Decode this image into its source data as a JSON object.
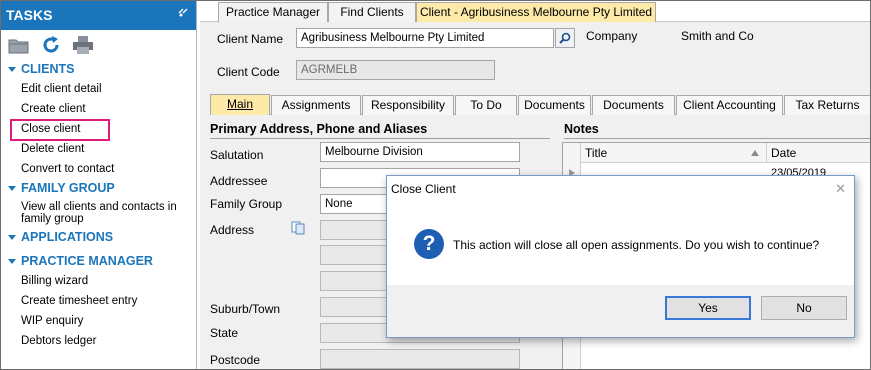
{
  "sidebar": {
    "title": "TASKS",
    "tool_icons": [
      "folder-icon",
      "refresh-icon",
      "print-icon"
    ],
    "sections": [
      {
        "label": "CLIENTS",
        "items": [
          "Edit client detail",
          "Create client",
          "Close client",
          "Delete client",
          "Convert to contact"
        ]
      },
      {
        "label": "FAMILY GROUP",
        "items": [
          "View all clients and contacts in family group"
        ]
      },
      {
        "label": "APPLICATIONS",
        "items": []
      },
      {
        "label": "PRACTICE MANAGER",
        "items": [
          "Billing wizard",
          "Create timesheet entry",
          "WIP enquiry",
          "Debtors ledger"
        ]
      }
    ]
  },
  "top_tabs": [
    "Practice Manager",
    "Find Clients",
    "Client - Agribusiness Melbourne Pty Limited"
  ],
  "client": {
    "name_label": "Client Name",
    "name_value": "Agribusiness Melbourne Pty Limited",
    "code_label": "Client Code",
    "code_value": "AGRMELB",
    "company_label": "Company",
    "company_value": "Smith and Co"
  },
  "inner_tabs": [
    "Main",
    "Assignments",
    "Responsibility",
    "To Do",
    "Documents",
    "Documents",
    "Client Accounting",
    "Tax Returns"
  ],
  "address_section": {
    "title": "Primary Address, Phone and Aliases",
    "salutation_label": "Salutation",
    "salutation_value": "Melbourne Division",
    "addressee_label": "Addressee",
    "family_group_label": "Family Group",
    "family_group_value": "None",
    "address_label": "Address",
    "suburb_label": "Suburb/Town",
    "state_label": "State",
    "postcode_label": "Postcode"
  },
  "notes": {
    "title": "Notes",
    "columns": [
      "Title",
      "Date"
    ],
    "rows": [
      {
        "title": "",
        "date": "23/05/2019"
      }
    ]
  },
  "dialog": {
    "title": "Close Client",
    "icon": "question-icon",
    "message": "This action will close all open assignments.  Do you wish to continue?",
    "yes": "Yes",
    "no": "No"
  },
  "colors": {
    "sidebar_header": "#1b75bb",
    "section_text": "#1b75bb",
    "active_tab": "#fde9a8",
    "highlight_box": "#e0197d",
    "dialog_icon": "#1e5fb4"
  }
}
